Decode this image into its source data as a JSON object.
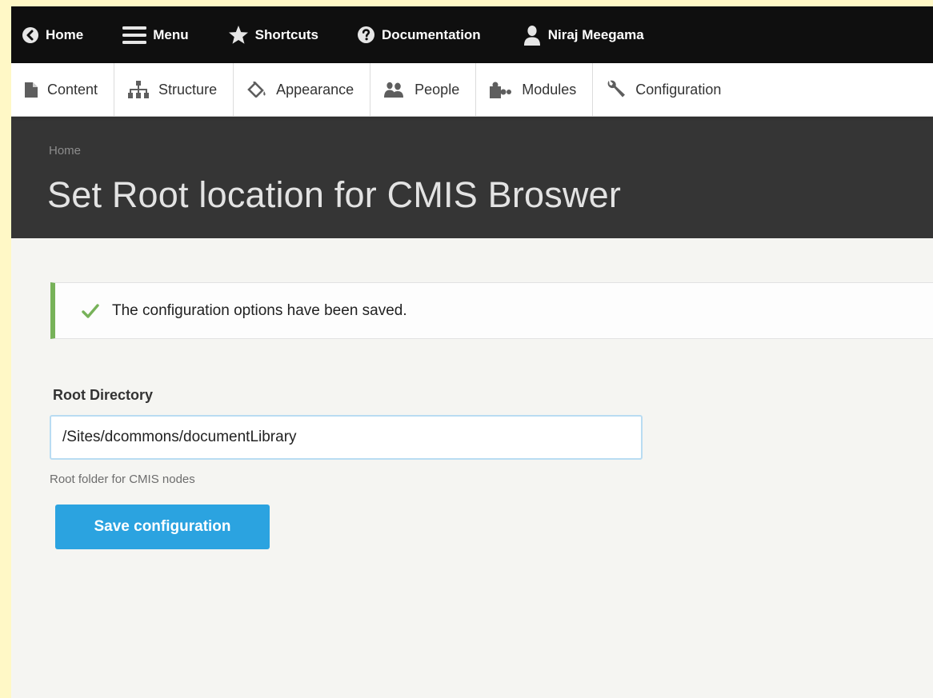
{
  "toolbar": {
    "items": [
      {
        "label": "Home",
        "icon": "chevron-left-circle-icon"
      },
      {
        "label": "Menu",
        "icon": "hamburger-icon"
      },
      {
        "label": "Shortcuts",
        "icon": "star-icon"
      },
      {
        "label": "Documentation",
        "icon": "question-circle-icon"
      },
      {
        "label": "Niraj Meegama",
        "icon": "user-icon"
      }
    ]
  },
  "tray": {
    "items": [
      {
        "label": "Content",
        "icon": "file-icon"
      },
      {
        "label": "Structure",
        "icon": "sitemap-icon"
      },
      {
        "label": "Appearance",
        "icon": "paint-bucket-icon"
      },
      {
        "label": "People",
        "icon": "people-icon"
      },
      {
        "label": "Modules",
        "icon": "puzzle-icon"
      },
      {
        "label": "Configuration",
        "icon": "wrench-icon"
      }
    ]
  },
  "header": {
    "breadcrumb": "Home",
    "title": "Set Root location for CMIS Broswer"
  },
  "status": {
    "message": "The configuration options have been saved.",
    "icon": "checkmark-icon",
    "accent_color": "#77b259"
  },
  "form": {
    "root_directory": {
      "label": "Root Directory",
      "value": "/Sites/dcommons/documentLibrary",
      "description": "Root folder for CMIS nodes"
    },
    "save_label": "Save configuration",
    "button_color": "#2ba3e0"
  }
}
